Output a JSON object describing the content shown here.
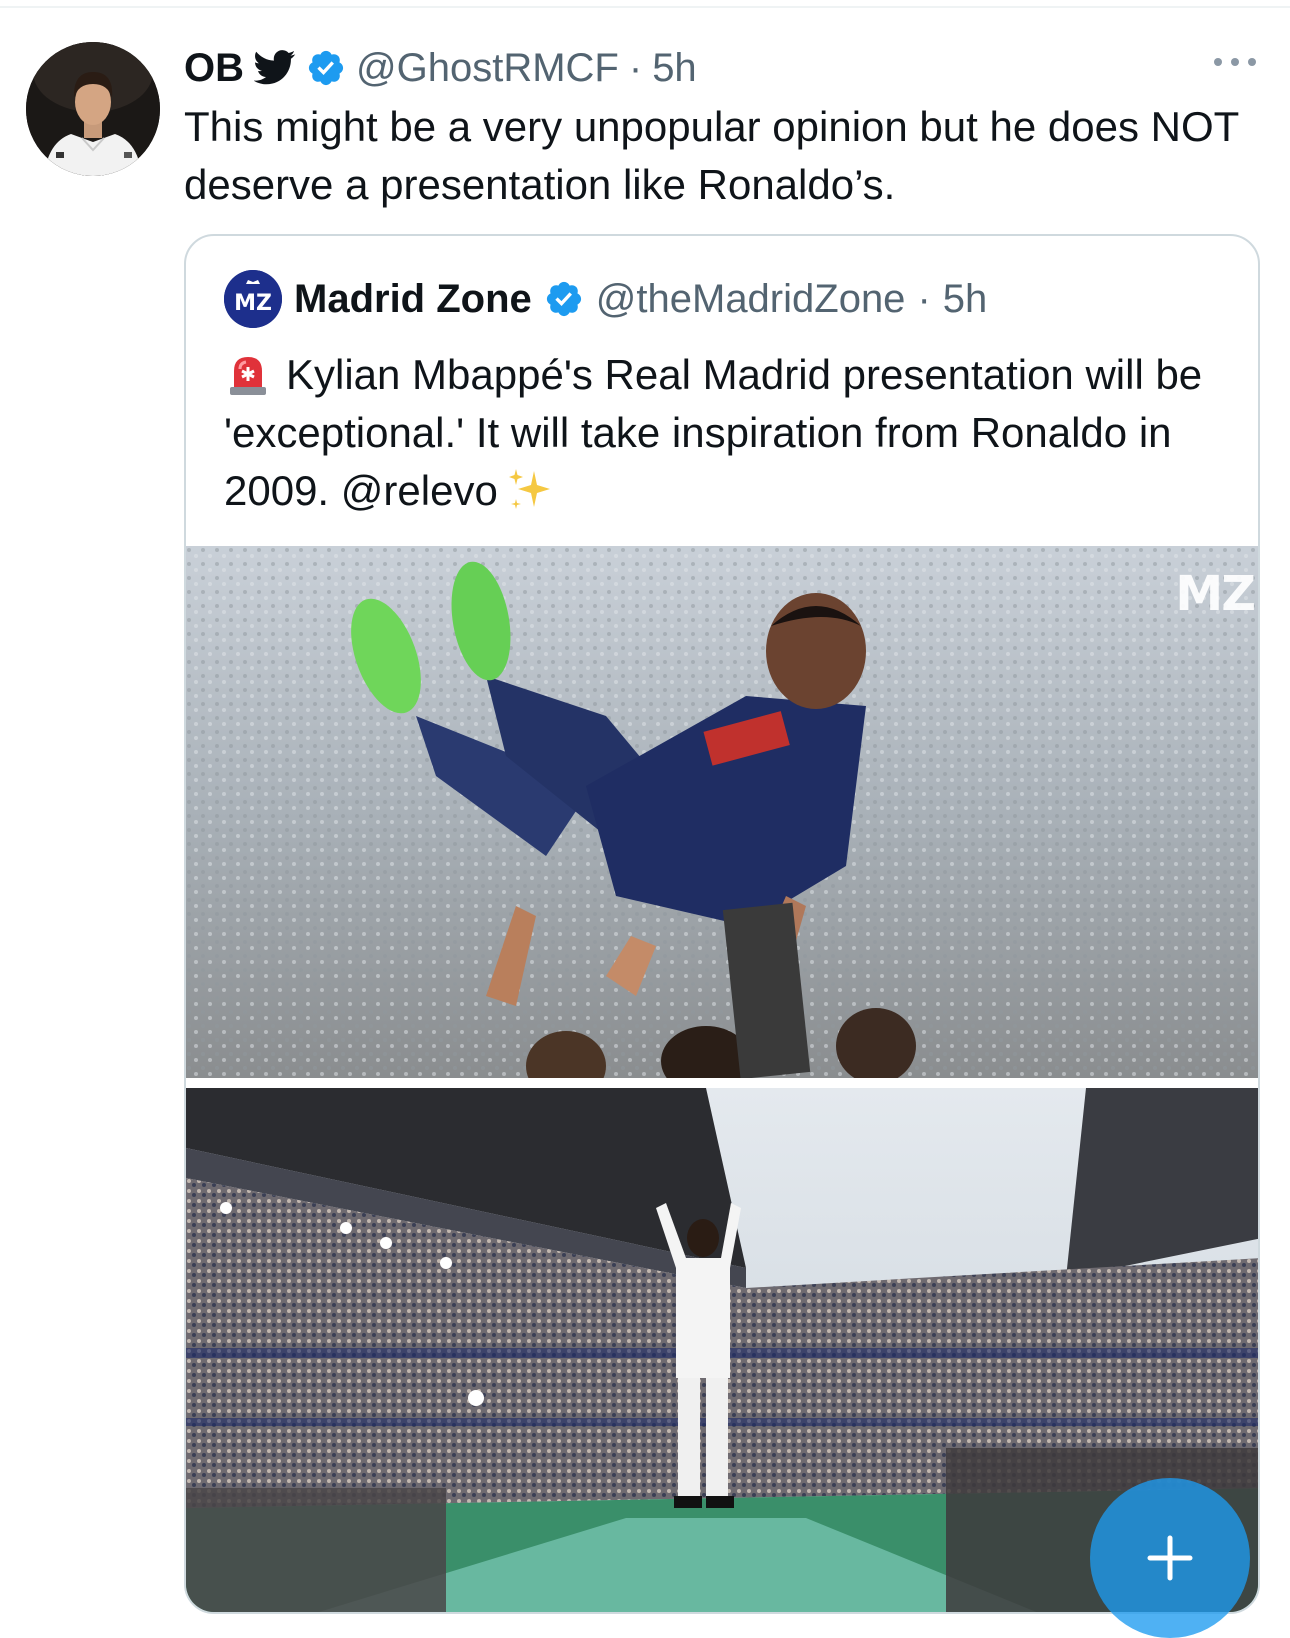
{
  "tweet": {
    "author_name": "OB",
    "handle": "@GhostRMCF",
    "separator": "·",
    "time": "5h",
    "text": "This might be a very unpopular opinion but he does NOT deserve a presentation like Ronaldo’s.",
    "icons": [
      "bird-icon",
      "verified-icon",
      "more-icon"
    ]
  },
  "quote": {
    "author_name": "Madrid Zone",
    "handle": "@theMadridZone",
    "separator": "·",
    "time": "5h",
    "text": "Kylian Mbappé's Real Madrid presentation will be 'exceptional.' It will take inspiration from Ronaldo in 2009. @relevo",
    "logo_text": "MZ",
    "watermark": "MZ",
    "icons": [
      "siren-icon",
      "sparkle-icon"
    ],
    "images": [
      "player-celebration-photo",
      "stadium-presentation-photo"
    ]
  },
  "fab": {
    "icon": "plus-icon"
  },
  "colors": {
    "text": "#0f1419",
    "secondary": "#536471",
    "verified": "#1d9bf0",
    "border": "#cfd9de",
    "mz_blue": "#1d2f8c"
  }
}
